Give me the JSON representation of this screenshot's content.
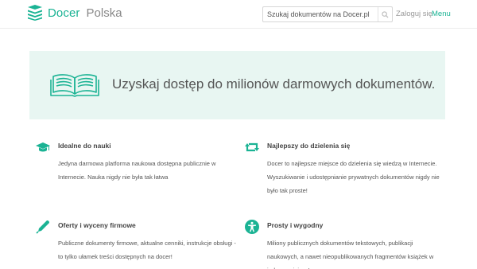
{
  "header": {
    "brand": "Docer",
    "country": "Polska",
    "search_placeholder": "Szukaj dokumentów na Docer.pl",
    "login_label": "Zaloguj się",
    "menu_label": "Menu"
  },
  "hero": {
    "text": "Uzyskaj dostęp do milionów darmowych dokumentów."
  },
  "features": [
    {
      "icon": "graduation-cap-icon",
      "title": "Idealne do nauki",
      "desc": "Jedyna darmowa platforma naukowa dostępna publicznie w Internecie. Nauka nigdy nie była tak łatwa"
    },
    {
      "icon": "share-arrows-icon",
      "title": "Najlepszy do dzielenia się",
      "desc": "Docer to najlepsze miejsce do dzielenia się wiedzą w Internecie. Wyszukiwanie i udostępnianie prywatnych dokumentów nigdy nie było tak proste!"
    },
    {
      "icon": "pen-icon",
      "title": "Oferty i wyceny firmowe",
      "desc": "Publiczne dokumenty firmowe, aktualne cenniki, instrukcje obsługi - to tylko ułamek treści dostępnych na docer!"
    },
    {
      "icon": "accessibility-icon",
      "title": "Prosty i wygodny",
      "desc": "Miliony publicznych dokumentów tekstowych, publikacji naukowych, a nawet nieopublikowanych fragmentów książek w jednym miejscu!"
    }
  ],
  "colors": {
    "accent": "#1bb394",
    "hero_bg": "#e8f6f2"
  }
}
